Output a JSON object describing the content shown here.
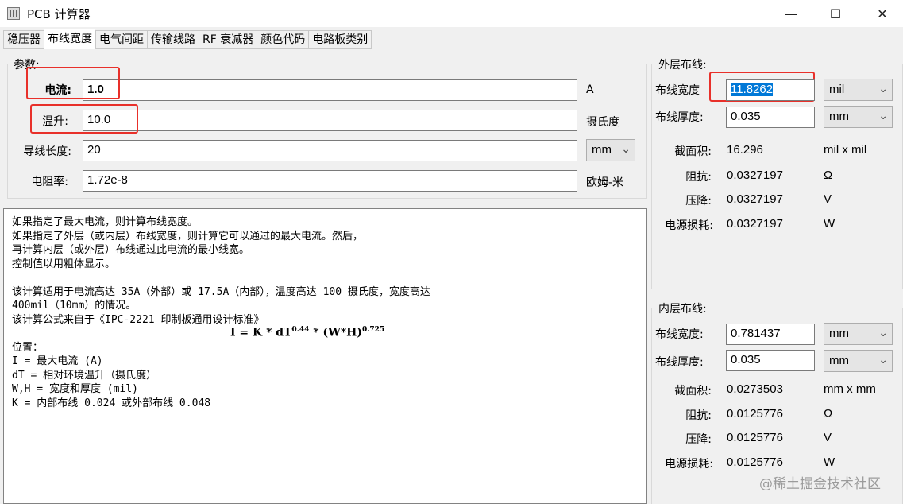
{
  "window": {
    "title": "PCB 计算器",
    "minimize": "—",
    "maximize": "☐",
    "close": "✕"
  },
  "tabs": [
    "稳压器",
    "布线宽度",
    "电气间距",
    "传输线路",
    "RF 衰减器",
    "颜色代码",
    "电路板类别"
  ],
  "params": {
    "group_label": "参数:",
    "current": {
      "label": "电流:",
      "value": "1.0",
      "unit": "A"
    },
    "temp_rise": {
      "label": "温升:",
      "value": "10.0",
      "unit": "摄氏度"
    },
    "conductor_length": {
      "label": "导线长度:",
      "value": "20",
      "unit": "mm"
    },
    "resistivity": {
      "label": "电阻率:",
      "value": "1.72e-8",
      "unit": "欧姆-米"
    }
  },
  "info": {
    "lines": [
      "如果指定了最大电流，则计算布线宽度。",
      "如果指定了外层（或内层）布线宽度，则计算它可以通过的最大电流。然后，",
      "再计算内层（或外层）布线通过此电流的最小线宽。",
      "控制值以用粗体显示。",
      "",
      "该计算适用于电流高达 35A（外部）或 17.5A（内部），温度高达 100 摄氏度，宽度高达",
      "400mil（10mm）的情况。",
      "该计算公式来自于《IPC-2221 印制板通用设计标准》"
    ],
    "formula_main": "I = K * dT",
    "formula_exp1": "0.44",
    "formula_mid": " * (W*H)",
    "formula_exp2": "0.725",
    "lines2": [
      "位置：",
      "I = 最大电流 (A)",
      "dT = 相对环境温升（摄氏度）",
      "W,H = 宽度和厚度 (mil)",
      "K = 内部布线 0.024 或外部布线 0.048"
    ]
  },
  "outer": {
    "group_label": "外层布线:",
    "width": {
      "label": "布线宽度",
      "value": "11.8262",
      "unit": "mil"
    },
    "thickness": {
      "label": "布线厚度:",
      "value": "0.035",
      "unit": "mm"
    },
    "area": {
      "label": "截面积:",
      "value": "16.296",
      "unit": "mil x mil"
    },
    "resistance": {
      "label": "阻抗:",
      "value": "0.0327197",
      "unit": "Ω"
    },
    "voltage_drop": {
      "label": "压降:",
      "value": "0.0327197",
      "unit": "V"
    },
    "power_loss": {
      "label": "电源损耗:",
      "value": "0.0327197",
      "unit": "W"
    }
  },
  "inner": {
    "group_label": "内层布线:",
    "width": {
      "label": "布线宽度:",
      "value": "0.781437",
      "unit": "mm"
    },
    "thickness": {
      "label": "布线厚度:",
      "value": "0.035",
      "unit": "mm"
    },
    "area": {
      "label": "截面积:",
      "value": "0.0273503",
      "unit": "mm x mm"
    },
    "resistance": {
      "label": "阻抗:",
      "value": "0.0125776",
      "unit": "Ω"
    },
    "voltage_drop": {
      "label": "压降:",
      "value": "0.0125776",
      "unit": "V"
    },
    "power_loss": {
      "label": "电源损耗:",
      "value": "0.0125776",
      "unit": "W"
    }
  },
  "watermark": "@稀土掘金技术社区",
  "colors": {
    "highlight": "#e8302a",
    "selection": "#0078d7"
  }
}
